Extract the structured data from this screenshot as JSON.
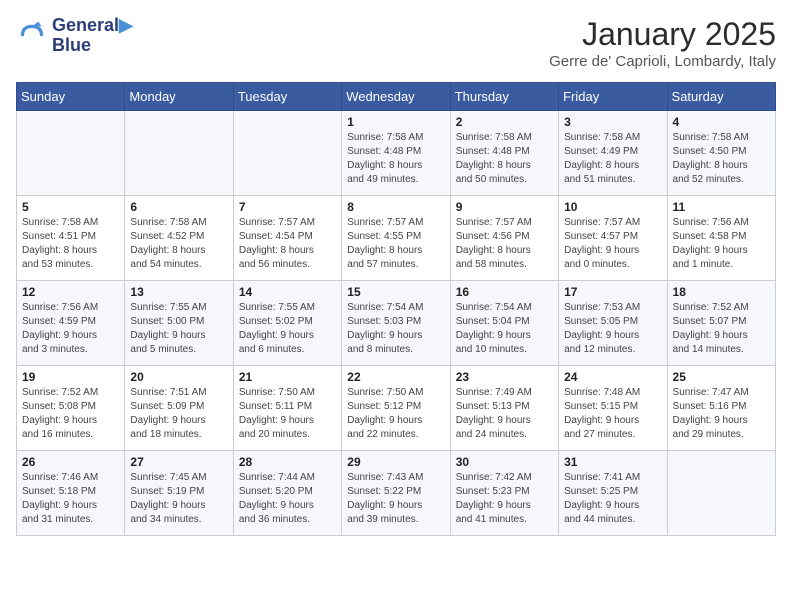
{
  "header": {
    "logo_line1": "General",
    "logo_line2": "Blue",
    "title": "January 2025",
    "subtitle": "Gerre de' Caprioli, Lombardy, Italy"
  },
  "days_of_week": [
    "Sunday",
    "Monday",
    "Tuesday",
    "Wednesday",
    "Thursday",
    "Friday",
    "Saturday"
  ],
  "weeks": [
    [
      {
        "day": "",
        "info": ""
      },
      {
        "day": "",
        "info": ""
      },
      {
        "day": "",
        "info": ""
      },
      {
        "day": "1",
        "info": "Sunrise: 7:58 AM\nSunset: 4:48 PM\nDaylight: 8 hours\nand 49 minutes."
      },
      {
        "day": "2",
        "info": "Sunrise: 7:58 AM\nSunset: 4:48 PM\nDaylight: 8 hours\nand 50 minutes."
      },
      {
        "day": "3",
        "info": "Sunrise: 7:58 AM\nSunset: 4:49 PM\nDaylight: 8 hours\nand 51 minutes."
      },
      {
        "day": "4",
        "info": "Sunrise: 7:58 AM\nSunset: 4:50 PM\nDaylight: 8 hours\nand 52 minutes."
      }
    ],
    [
      {
        "day": "5",
        "info": "Sunrise: 7:58 AM\nSunset: 4:51 PM\nDaylight: 8 hours\nand 53 minutes."
      },
      {
        "day": "6",
        "info": "Sunrise: 7:58 AM\nSunset: 4:52 PM\nDaylight: 8 hours\nand 54 minutes."
      },
      {
        "day": "7",
        "info": "Sunrise: 7:57 AM\nSunset: 4:54 PM\nDaylight: 8 hours\nand 56 minutes."
      },
      {
        "day": "8",
        "info": "Sunrise: 7:57 AM\nSunset: 4:55 PM\nDaylight: 8 hours\nand 57 minutes."
      },
      {
        "day": "9",
        "info": "Sunrise: 7:57 AM\nSunset: 4:56 PM\nDaylight: 8 hours\nand 58 minutes."
      },
      {
        "day": "10",
        "info": "Sunrise: 7:57 AM\nSunset: 4:57 PM\nDaylight: 9 hours\nand 0 minutes."
      },
      {
        "day": "11",
        "info": "Sunrise: 7:56 AM\nSunset: 4:58 PM\nDaylight: 9 hours\nand 1 minute."
      }
    ],
    [
      {
        "day": "12",
        "info": "Sunrise: 7:56 AM\nSunset: 4:59 PM\nDaylight: 9 hours\nand 3 minutes."
      },
      {
        "day": "13",
        "info": "Sunrise: 7:55 AM\nSunset: 5:00 PM\nDaylight: 9 hours\nand 5 minutes."
      },
      {
        "day": "14",
        "info": "Sunrise: 7:55 AM\nSunset: 5:02 PM\nDaylight: 9 hours\nand 6 minutes."
      },
      {
        "day": "15",
        "info": "Sunrise: 7:54 AM\nSunset: 5:03 PM\nDaylight: 9 hours\nand 8 minutes."
      },
      {
        "day": "16",
        "info": "Sunrise: 7:54 AM\nSunset: 5:04 PM\nDaylight: 9 hours\nand 10 minutes."
      },
      {
        "day": "17",
        "info": "Sunrise: 7:53 AM\nSunset: 5:05 PM\nDaylight: 9 hours\nand 12 minutes."
      },
      {
        "day": "18",
        "info": "Sunrise: 7:52 AM\nSunset: 5:07 PM\nDaylight: 9 hours\nand 14 minutes."
      }
    ],
    [
      {
        "day": "19",
        "info": "Sunrise: 7:52 AM\nSunset: 5:08 PM\nDaylight: 9 hours\nand 16 minutes."
      },
      {
        "day": "20",
        "info": "Sunrise: 7:51 AM\nSunset: 5:09 PM\nDaylight: 9 hours\nand 18 minutes."
      },
      {
        "day": "21",
        "info": "Sunrise: 7:50 AM\nSunset: 5:11 PM\nDaylight: 9 hours\nand 20 minutes."
      },
      {
        "day": "22",
        "info": "Sunrise: 7:50 AM\nSunset: 5:12 PM\nDaylight: 9 hours\nand 22 minutes."
      },
      {
        "day": "23",
        "info": "Sunrise: 7:49 AM\nSunset: 5:13 PM\nDaylight: 9 hours\nand 24 minutes."
      },
      {
        "day": "24",
        "info": "Sunrise: 7:48 AM\nSunset: 5:15 PM\nDaylight: 9 hours\nand 27 minutes."
      },
      {
        "day": "25",
        "info": "Sunrise: 7:47 AM\nSunset: 5:16 PM\nDaylight: 9 hours\nand 29 minutes."
      }
    ],
    [
      {
        "day": "26",
        "info": "Sunrise: 7:46 AM\nSunset: 5:18 PM\nDaylight: 9 hours\nand 31 minutes."
      },
      {
        "day": "27",
        "info": "Sunrise: 7:45 AM\nSunset: 5:19 PM\nDaylight: 9 hours\nand 34 minutes."
      },
      {
        "day": "28",
        "info": "Sunrise: 7:44 AM\nSunset: 5:20 PM\nDaylight: 9 hours\nand 36 minutes."
      },
      {
        "day": "29",
        "info": "Sunrise: 7:43 AM\nSunset: 5:22 PM\nDaylight: 9 hours\nand 39 minutes."
      },
      {
        "day": "30",
        "info": "Sunrise: 7:42 AM\nSunset: 5:23 PM\nDaylight: 9 hours\nand 41 minutes."
      },
      {
        "day": "31",
        "info": "Sunrise: 7:41 AM\nSunset: 5:25 PM\nDaylight: 9 hours\nand 44 minutes."
      },
      {
        "day": "",
        "info": ""
      }
    ]
  ]
}
